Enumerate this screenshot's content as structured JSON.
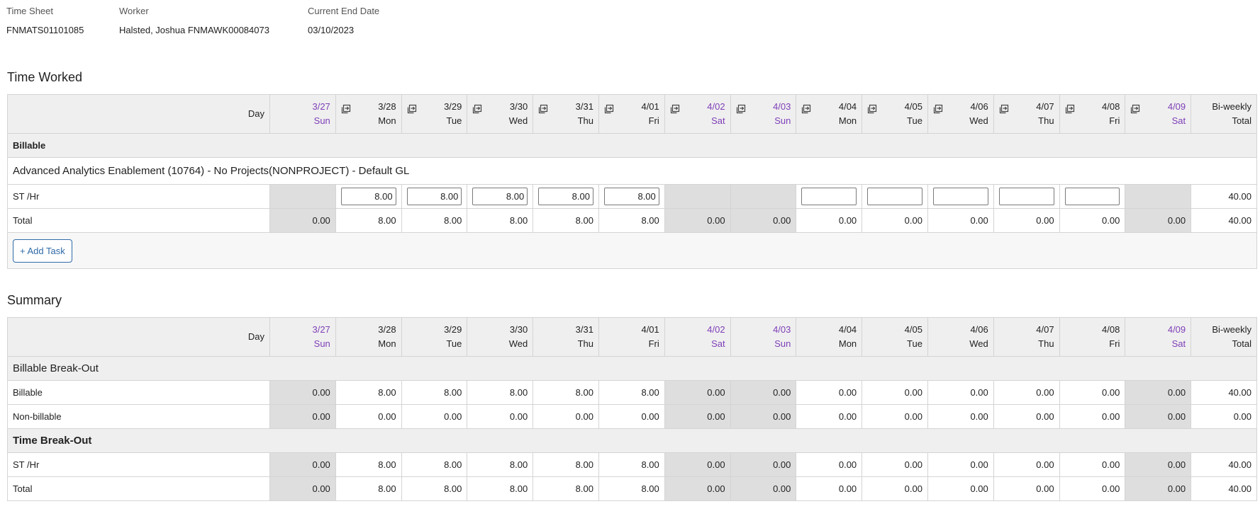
{
  "header": {
    "timesheet_label": "Time Sheet",
    "timesheet_value": "FNMATS01101085",
    "worker_label": "Worker",
    "worker_value": "Halsted, Joshua FNMAWK00084073",
    "end_date_label": "Current End Date",
    "end_date_value": "03/10/2023"
  },
  "time_worked": {
    "title": "Time Worked",
    "day_label": "Day",
    "days": [
      {
        "date": "3/27",
        "dow": "Sun",
        "weekend": true,
        "copy_icon": false
      },
      {
        "date": "3/28",
        "dow": "Mon",
        "weekend": false,
        "copy_icon": true
      },
      {
        "date": "3/29",
        "dow": "Tue",
        "weekend": false,
        "copy_icon": true
      },
      {
        "date": "3/30",
        "dow": "Wed",
        "weekend": false,
        "copy_icon": true
      },
      {
        "date": "3/31",
        "dow": "Thu",
        "weekend": false,
        "copy_icon": true
      },
      {
        "date": "4/01",
        "dow": "Fri",
        "weekend": false,
        "copy_icon": true
      },
      {
        "date": "4/02",
        "dow": "Sat",
        "weekend": true,
        "copy_icon": true
      },
      {
        "date": "4/03",
        "dow": "Sun",
        "weekend": true,
        "copy_icon": true
      },
      {
        "date": "4/04",
        "dow": "Mon",
        "weekend": false,
        "copy_icon": true
      },
      {
        "date": "4/05",
        "dow": "Tue",
        "weekend": false,
        "copy_icon": true
      },
      {
        "date": "4/06",
        "dow": "Wed",
        "weekend": false,
        "copy_icon": true
      },
      {
        "date": "4/07",
        "dow": "Thu",
        "weekend": false,
        "copy_icon": true
      },
      {
        "date": "4/08",
        "dow": "Fri",
        "weekend": false,
        "copy_icon": true
      },
      {
        "date": "4/09",
        "dow": "Sat",
        "weekend": true,
        "copy_icon": true
      }
    ],
    "total_header_line1": "Bi-weekly",
    "total_header_line2": "Total",
    "group_label": "Billable",
    "project_label": "Advanced Analytics Enablement (10764) - No Projects(NONPROJECT) - Default GL",
    "task_row": {
      "label": "ST /Hr",
      "cells": [
        {
          "input": false,
          "value": ""
        },
        {
          "input": true,
          "value": "8.00"
        },
        {
          "input": true,
          "value": "8.00"
        },
        {
          "input": true,
          "value": "8.00"
        },
        {
          "input": true,
          "value": "8.00"
        },
        {
          "input": true,
          "value": "8.00"
        },
        {
          "input": false,
          "value": ""
        },
        {
          "input": false,
          "value": ""
        },
        {
          "input": true,
          "value": ""
        },
        {
          "input": true,
          "value": ""
        },
        {
          "input": true,
          "value": ""
        },
        {
          "input": true,
          "value": ""
        },
        {
          "input": true,
          "value": ""
        },
        {
          "input": false,
          "value": ""
        }
      ],
      "total": "40.00"
    },
    "total_row": {
      "label": "Total",
      "values": [
        "0.00",
        "8.00",
        "8.00",
        "8.00",
        "8.00",
        "8.00",
        "0.00",
        "0.00",
        "0.00",
        "0.00",
        "0.00",
        "0.00",
        "0.00",
        "0.00"
      ],
      "total": "40.00"
    },
    "add_task_label": "+ Add Task"
  },
  "summary": {
    "title": "Summary",
    "day_label": "Day",
    "days": [
      {
        "date": "3/27",
        "dow": "Sun",
        "weekend": true
      },
      {
        "date": "3/28",
        "dow": "Mon",
        "weekend": false
      },
      {
        "date": "3/29",
        "dow": "Tue",
        "weekend": false
      },
      {
        "date": "3/30",
        "dow": "Wed",
        "weekend": false
      },
      {
        "date": "3/31",
        "dow": "Thu",
        "weekend": false
      },
      {
        "date": "4/01",
        "dow": "Fri",
        "weekend": false
      },
      {
        "date": "4/02",
        "dow": "Sat",
        "weekend": true
      },
      {
        "date": "4/03",
        "dow": "Sun",
        "weekend": true
      },
      {
        "date": "4/04",
        "dow": "Mon",
        "weekend": false
      },
      {
        "date": "4/05",
        "dow": "Tue",
        "weekend": false
      },
      {
        "date": "4/06",
        "dow": "Wed",
        "weekend": false
      },
      {
        "date": "4/07",
        "dow": "Thu",
        "weekend": false
      },
      {
        "date": "4/08",
        "dow": "Fri",
        "weekend": false
      },
      {
        "date": "4/09",
        "dow": "Sat",
        "weekend": true
      }
    ],
    "total_header_line1": "Bi-weekly",
    "total_header_line2": "Total",
    "sections": [
      {
        "title": "Billable Break-Out",
        "bold": false,
        "rows": [
          {
            "label": "Billable",
            "values": [
              "0.00",
              "8.00",
              "8.00",
              "8.00",
              "8.00",
              "8.00",
              "0.00",
              "0.00",
              "0.00",
              "0.00",
              "0.00",
              "0.00",
              "0.00",
              "0.00"
            ],
            "total": "40.00"
          },
          {
            "label": "Non-billable",
            "values": [
              "0.00",
              "0.00",
              "0.00",
              "0.00",
              "0.00",
              "0.00",
              "0.00",
              "0.00",
              "0.00",
              "0.00",
              "0.00",
              "0.00",
              "0.00",
              "0.00"
            ],
            "total": "0.00"
          }
        ]
      },
      {
        "title": "Time Break-Out",
        "bold": true,
        "rows": [
          {
            "label": "ST /Hr",
            "values": [
              "0.00",
              "8.00",
              "8.00",
              "8.00",
              "8.00",
              "8.00",
              "0.00",
              "0.00",
              "0.00",
              "0.00",
              "0.00",
              "0.00",
              "0.00",
              "0.00"
            ],
            "total": "40.00"
          },
          {
            "label": "Total",
            "values": [
              "0.00",
              "8.00",
              "8.00",
              "8.00",
              "8.00",
              "8.00",
              "0.00",
              "0.00",
              "0.00",
              "0.00",
              "0.00",
              "0.00",
              "0.00",
              "0.00"
            ],
            "total": "40.00"
          }
        ]
      }
    ]
  },
  "icons": {
    "copy_day": "copy-day-icon"
  },
  "colors": {
    "weekend_text": "#7e3eb8",
    "weekend_bg": "#dedede",
    "header_bg": "#efefef",
    "button": "#2f6aa8"
  }
}
